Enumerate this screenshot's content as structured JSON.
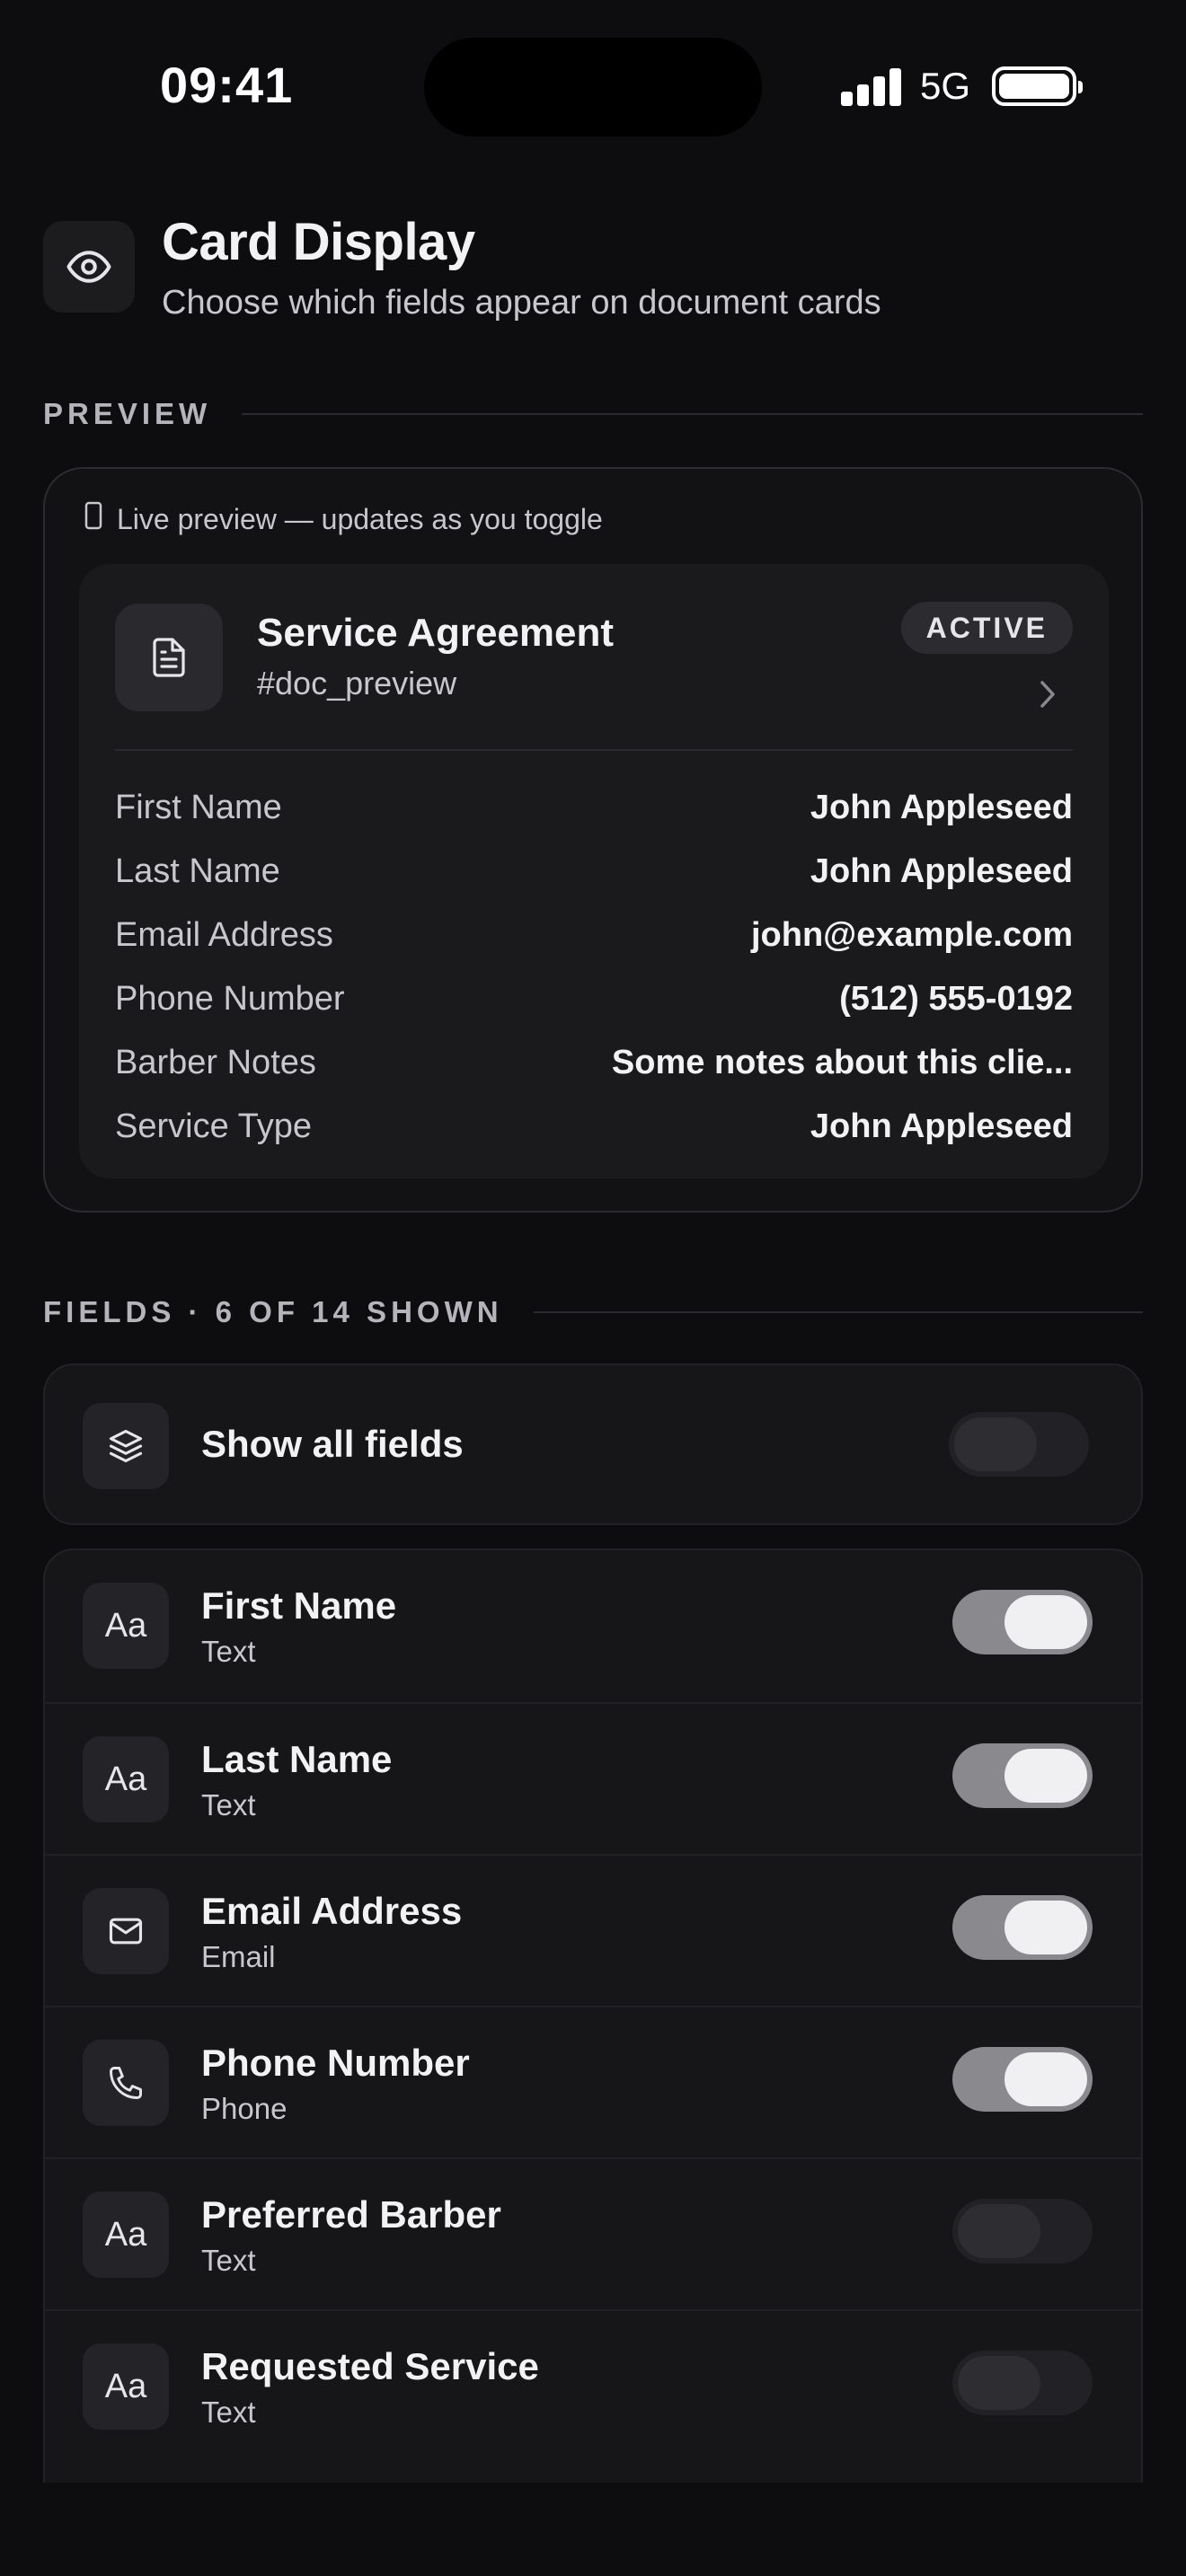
{
  "status_bar": {
    "time": "09:41",
    "network": "5G"
  },
  "header": {
    "icon": "eye-icon",
    "title": "Card Display",
    "subtitle": "Choose which fields appear on document cards"
  },
  "preview": {
    "section_label": "PREVIEW",
    "note_icon": "phone-outline-icon",
    "note": "Live preview — updates as you toggle",
    "card": {
      "icon": "document-icon",
      "title": "Service Agreement",
      "id": "#doc_preview",
      "badge": "ACTIVE",
      "rows": [
        {
          "label": "First Name",
          "value": "John Appleseed"
        },
        {
          "label": "Last Name",
          "value": "John Appleseed"
        },
        {
          "label": "Email Address",
          "value": "john@example.com"
        },
        {
          "label": "Phone Number",
          "value": "(512) 555-0192"
        },
        {
          "label": "Barber Notes",
          "value": "Some notes about this clie..."
        },
        {
          "label": "Service Type",
          "value": "John Appleseed"
        }
      ]
    }
  },
  "fields": {
    "section_label": "FIELDS · 6 OF 14 SHOWN",
    "show_all": {
      "icon": "layers-icon",
      "label": "Show all fields",
      "enabled": false
    },
    "items": [
      {
        "icon": "text-icon",
        "icon_glyph": "Aa",
        "name": "First Name",
        "type": "Text",
        "enabled": true
      },
      {
        "icon": "text-icon",
        "icon_glyph": "Aa",
        "name": "Last Name",
        "type": "Text",
        "enabled": true
      },
      {
        "icon": "mail-icon",
        "icon_glyph": "",
        "name": "Email Address",
        "type": "Email",
        "enabled": true
      },
      {
        "icon": "phone-icon",
        "icon_glyph": "",
        "name": "Phone Number",
        "type": "Phone",
        "enabled": true
      },
      {
        "icon": "text-icon",
        "icon_glyph": "Aa",
        "name": "Preferred Barber",
        "type": "Text",
        "enabled": false
      },
      {
        "icon": "text-icon",
        "icon_glyph": "Aa",
        "name": "Requested Service",
        "type": "Text",
        "enabled": false
      }
    ]
  },
  "colors": {
    "background": "#0d0d0f",
    "card": "#161618",
    "toggle_on": "#8a8a8e",
    "toggle_off": "#222226"
  }
}
